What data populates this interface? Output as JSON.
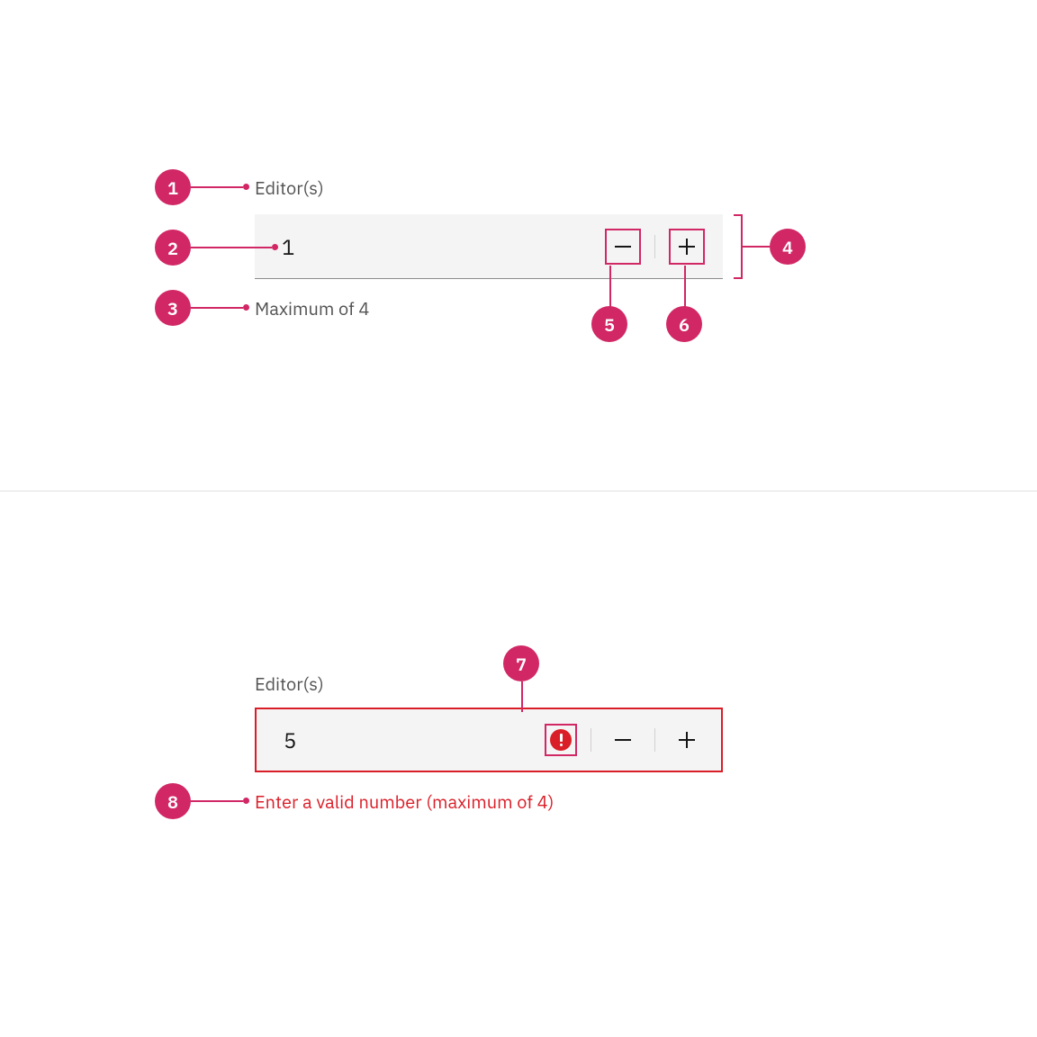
{
  "annotations": {
    "1": "1",
    "2": "2",
    "3": "3",
    "4": "4",
    "5": "5",
    "6": "6",
    "7": "7",
    "8": "8"
  },
  "example_a": {
    "label": "Editor(s)",
    "value": "1",
    "helper": "Maximum of 4"
  },
  "example_b": {
    "label": "Editor(s)",
    "value": "5",
    "error": "Enter a valid number (maximum of 4)"
  },
  "colors": {
    "accent": "#d12765",
    "error": "#da1e28",
    "field_bg": "#f4f4f4",
    "text_secondary": "#525252"
  }
}
